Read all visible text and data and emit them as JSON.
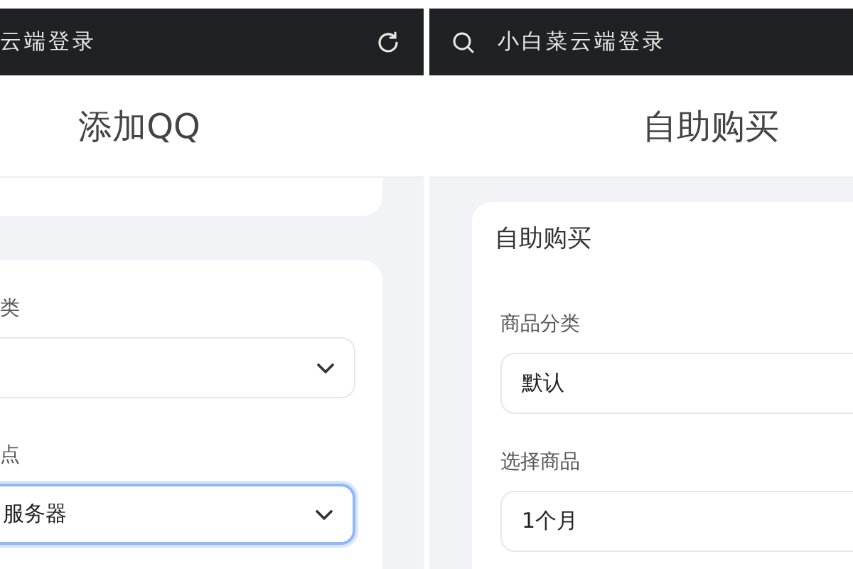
{
  "left_screen": {
    "top_bar": {
      "title": "云端登录"
    },
    "header": {
      "title": "添加QQ"
    },
    "fields": [
      {
        "label": "类",
        "focused": false
      },
      {
        "label": "点",
        "value": "服务器",
        "focused": true
      }
    ]
  },
  "right_screen": {
    "top_bar": {
      "title": "小白菜云端登录"
    },
    "header": {
      "title": "自助购买"
    },
    "card": {
      "title": "自助购买"
    },
    "fields": [
      {
        "label": "商品分类",
        "value": "默认",
        "focused": false
      },
      {
        "label": "选择商品",
        "value": "1个月",
        "focused": false
      }
    ]
  }
}
